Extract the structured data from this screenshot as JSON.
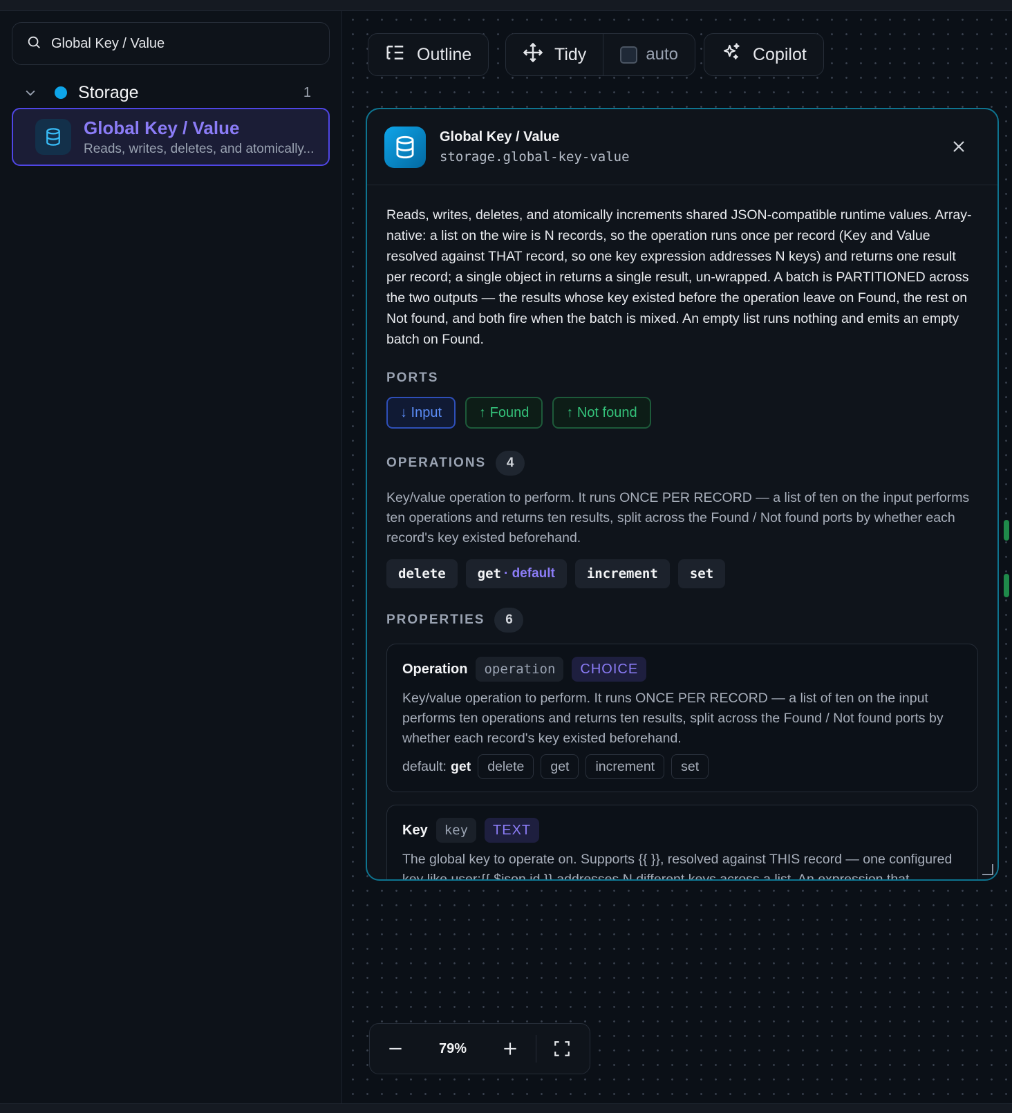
{
  "sidebar": {
    "search_value": "Global Key / Value",
    "group": {
      "label": "Storage",
      "count": "1"
    },
    "item": {
      "title": "Global Key / Value",
      "subtitle": "Reads, writes, deletes, and atomically..."
    }
  },
  "toolbar": {
    "outline_label": "Outline",
    "tidy_label": "Tidy",
    "auto_label": "auto",
    "copilot_label": "Copilot"
  },
  "panel": {
    "title": "Global Key / Value",
    "id": "storage.global-key-value",
    "description": "Reads, writes, deletes, and atomically increments shared JSON-compatible runtime values. Array-native: a list on the wire is N records, so the operation runs once per record (Key and Value resolved against THAT record, so one key expression addresses N keys) and returns one result per record; a single object in returns a single result, un-wrapped. A batch is PARTITIONED across the two outputs — the results whose key existed before the operation leave on Found, the rest on Not found, and both fire when the batch is mixed. An empty list runs nothing and emits an empty batch on Found.",
    "ports_title": "PORTS",
    "ports": {
      "input": "↓ Input",
      "found": "↑ Found",
      "not_found": "↑ Not found"
    },
    "operations_title": "OPERATIONS",
    "operations_count": "4",
    "operations_desc": "Key/value operation to perform. It runs ONCE PER RECORD — a list of ten on the input performs ten operations and returns ten results, split across the Found / Not found ports by whether each record's key existed beforehand.",
    "operations": {
      "delete": "delete",
      "get": "get",
      "get_default": "· default",
      "increment": "increment",
      "set": "set"
    },
    "properties_title": "PROPERTIES",
    "properties_count": "6",
    "prop_operation": {
      "name": "Operation",
      "key": "operation",
      "type": "CHOICE",
      "desc": "Key/value operation to perform. It runs ONCE PER RECORD — a list of ten on the input performs ten operations and returns ten results, split across the Found / Not found ports by whether each record's key existed beforehand.",
      "default_label": "default:",
      "default_value": "get",
      "options": {
        "o1": "delete",
        "o2": "get",
        "o3": "increment",
        "o4": "set"
      }
    },
    "prop_key": {
      "name": "Key",
      "key": "key",
      "type": "TEXT",
      "desc": "The global key to operate on. Supports {{ }}, resolved against THIS record — one configured key like user:{{ $json.id }} addresses N different keys across a list. An expression that resolves"
    }
  },
  "zoom": {
    "value": "79%"
  },
  "colors": {
    "accent": "#8b7cf6",
    "brand": "#0ea5e9",
    "found": "#34c27a",
    "input": "#5b8cf5"
  }
}
